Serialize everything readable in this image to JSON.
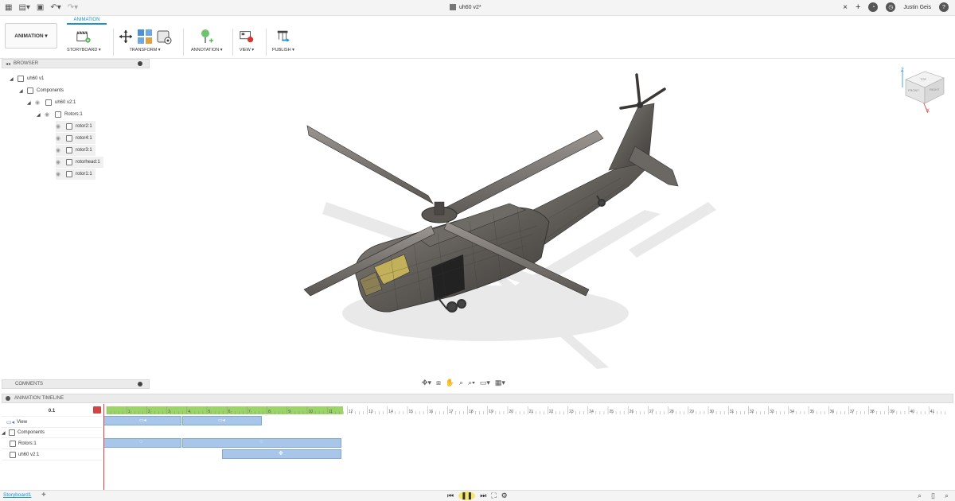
{
  "window": {
    "doc_title": "uh60 v2*",
    "user": "Justin Geis",
    "close_glyph": "×",
    "new_tab_glyph": "+",
    "help_glyph": "?"
  },
  "toolbar": {
    "workspace": "ANIMATION ▾",
    "active_tab": "ANIMATION",
    "groups": [
      {
        "label": "STORYBOARD ▾",
        "icon": "storyboard-icon"
      },
      {
        "label": "TRANSFORM ▾",
        "icon": "transform-icon"
      },
      {
        "label": "ANNOTATION ▾",
        "icon": "annotation-icon"
      },
      {
        "label": "VIEW ▾",
        "icon": "view-record-icon"
      },
      {
        "label": "PUBLISH ▾",
        "icon": "publish-icon"
      }
    ]
  },
  "browser": {
    "title": "BROWSER",
    "items": [
      {
        "label": "uh60 v1"
      },
      {
        "label": "Components"
      },
      {
        "label": "uh60 v2:1"
      },
      {
        "label": "Rotors:1"
      },
      {
        "label": "rotor2:1"
      },
      {
        "label": "rotor4:1"
      },
      {
        "label": "rotor3:1"
      },
      {
        "label": "rotorhead:1"
      },
      {
        "label": "rotor1:1"
      }
    ]
  },
  "viewcube": {
    "top": "TOP",
    "front": "FRONT",
    "right": "RIGHT",
    "axis_z": "Z",
    "axis_x": "X"
  },
  "comments": {
    "title": "COMMENTS"
  },
  "timeline": {
    "title": "ANIMATION TIMELINE",
    "current_time": "0.1",
    "tracks": [
      {
        "label": "View"
      },
      {
        "label": "Components"
      },
      {
        "label": "Rotors:1"
      },
      {
        "label": "uh60 v2:1"
      }
    ],
    "ticks": [
      "1",
      "2",
      "3",
      "4",
      "5",
      "6",
      "7",
      "8",
      "9",
      "10",
      "11",
      "12",
      "13",
      "14",
      "15",
      "16",
      "17",
      "18",
      "19",
      "20",
      "21",
      "22",
      "23",
      "24",
      "25",
      "26",
      "27",
      "28",
      "29",
      "30",
      "31",
      "32",
      "33",
      "34",
      "35",
      "36",
      "37",
      "38",
      "39",
      "40",
      "41",
      "42"
    ],
    "green_range_end": 11.8
  },
  "status": {
    "storyboard_tab": "Storyboard1",
    "add_glyph": "+"
  },
  "colors": {
    "accent": "#1a8fd6",
    "timeline_green": "#9bd568",
    "track_blue": "#a8c6ea",
    "playhead": "#d24545"
  }
}
